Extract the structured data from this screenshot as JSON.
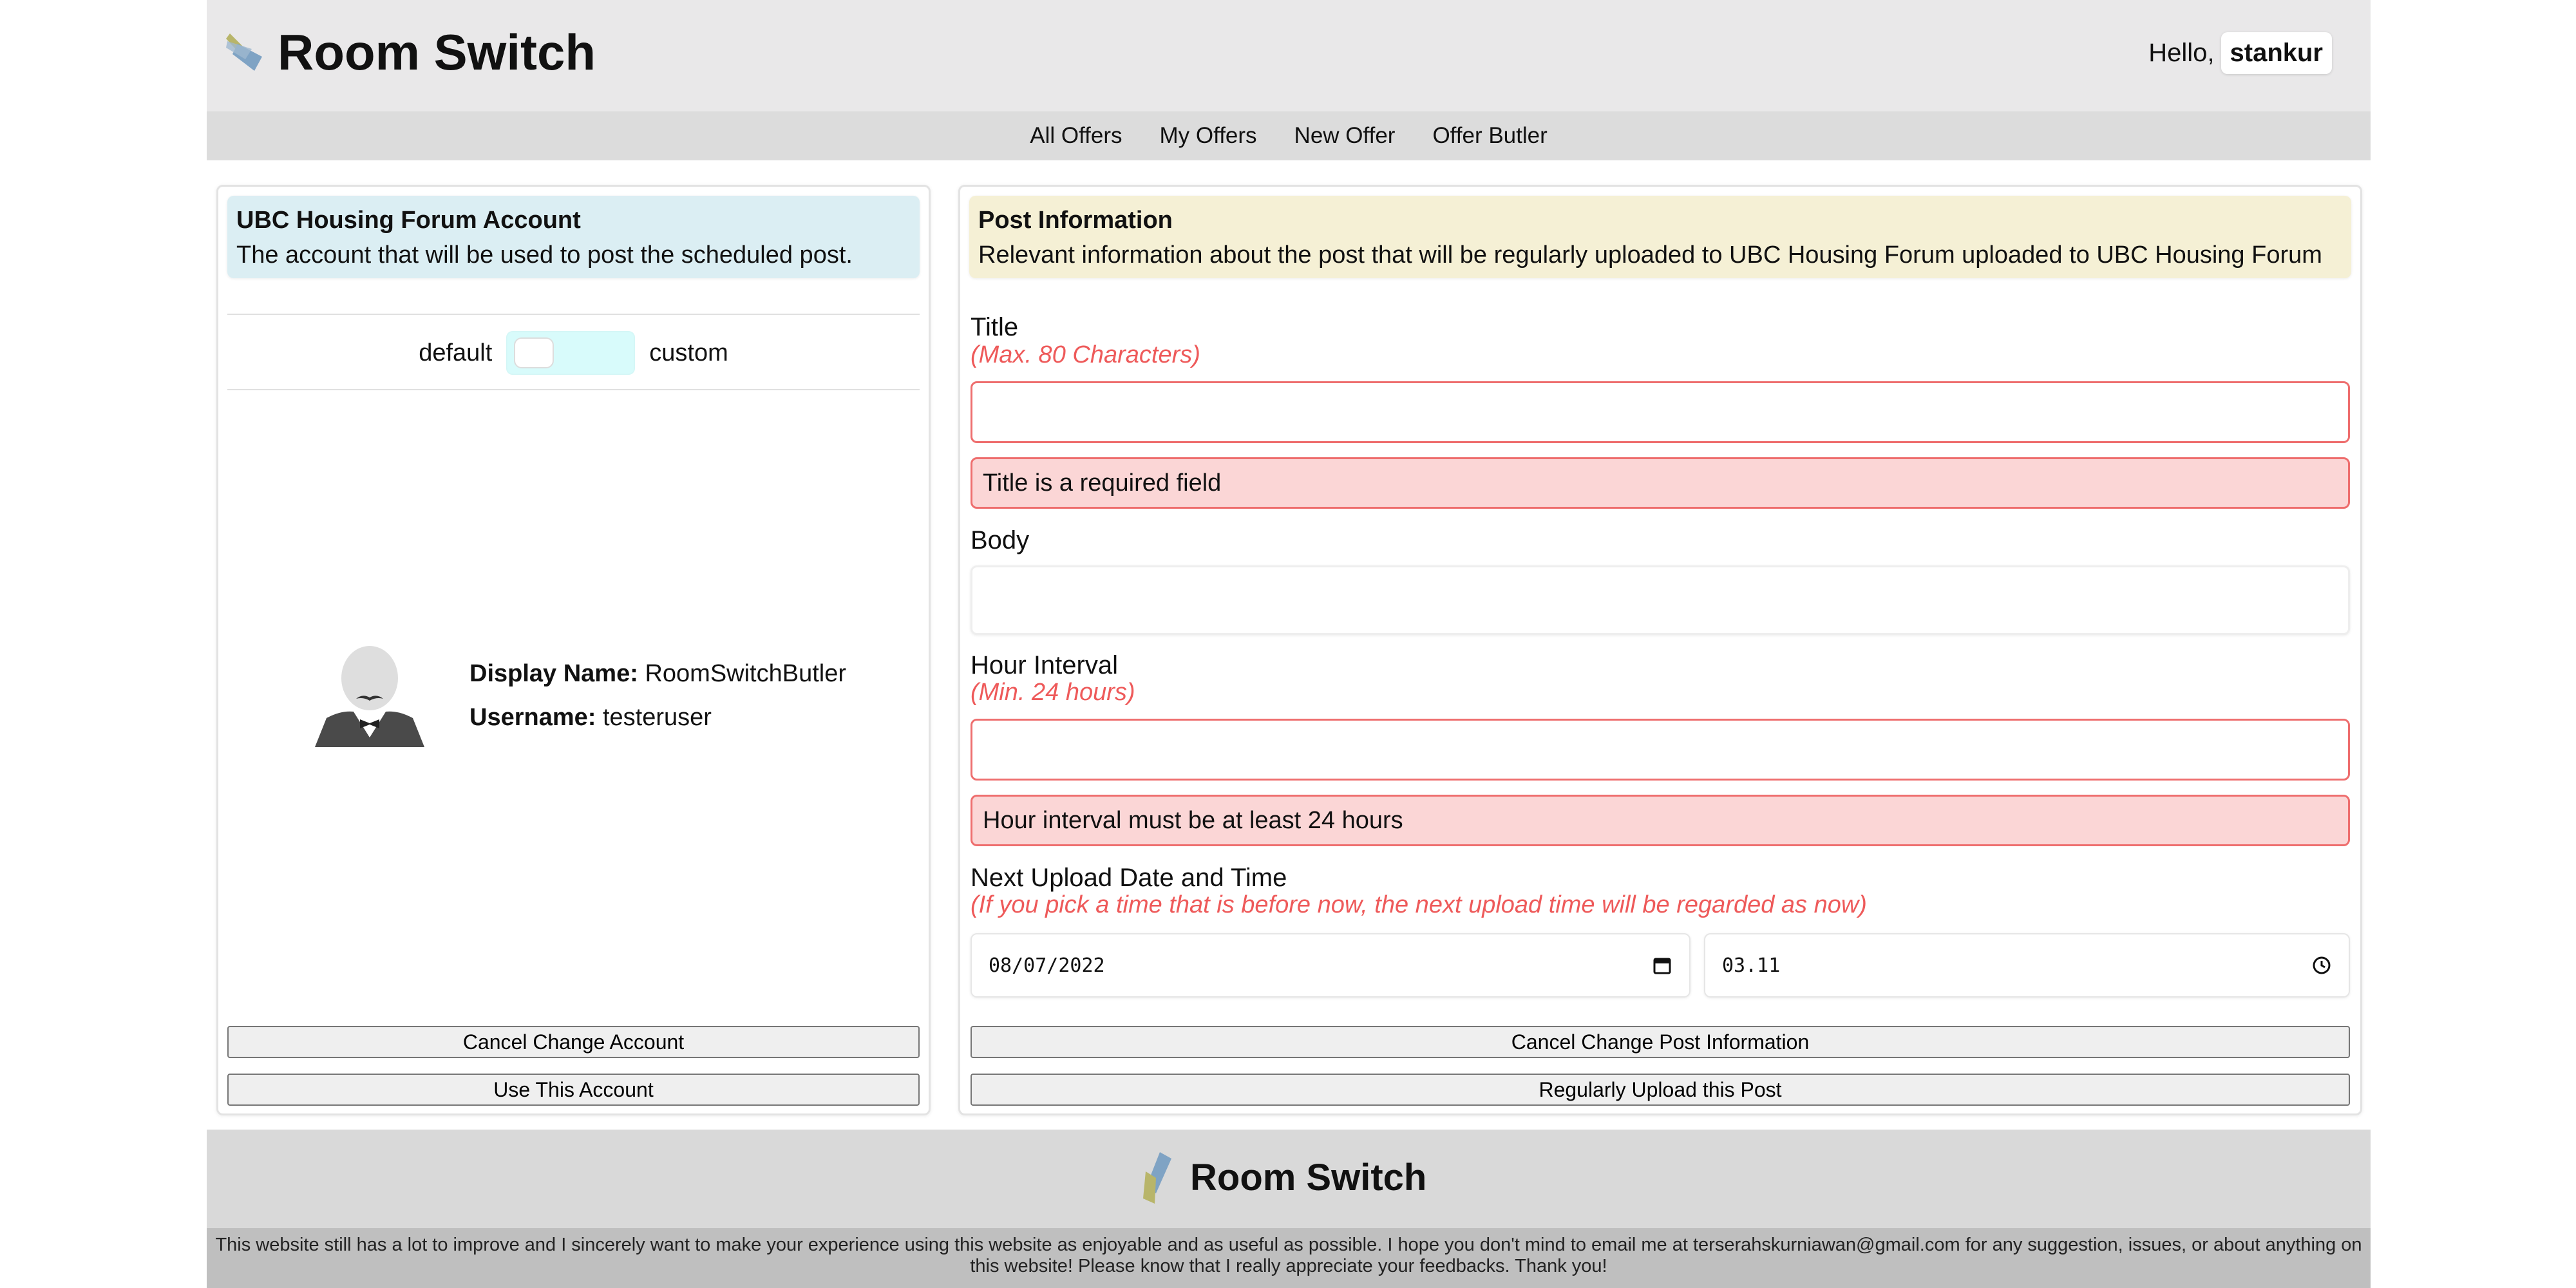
{
  "header": {
    "app_title": "Room Switch",
    "greeting": "Hello,",
    "username": "stankur"
  },
  "nav": {
    "items": [
      "All Offers",
      "My Offers",
      "New Offer",
      "Offer Butler"
    ]
  },
  "left_panel": {
    "info_title": "UBC Housing Forum Account",
    "info_sub": "The account that will be used to post the scheduled post.",
    "toggle_left": "default",
    "toggle_right": "custom",
    "display_name_label": "Display Name:",
    "display_name": "RoomSwitchButler",
    "username_label": "Username:",
    "username": "testeruser",
    "cancel_button": "Cancel Change Account",
    "use_button": "Use This Account"
  },
  "right_panel": {
    "info_title": "Post Information",
    "info_sub": "Relevant information about the post that will be regularly uploaded to UBC Housing Forum uploaded to UBC Housing Forum",
    "title_label": "Title",
    "title_hint": "(Max. 80 Characters)",
    "title_value": "",
    "title_error": "Title is a required field",
    "body_label": "Body",
    "body_value": "",
    "interval_label": "Hour Interval",
    "interval_hint": "(Min. 24 hours)",
    "interval_value": "",
    "interval_error": "Hour interval must be at least 24 hours",
    "next_upload_label": "Next Upload Date and Time",
    "next_upload_hint": "(If you pick a time that is before now, the next upload time will be regarded as now)",
    "date_value": "08/07/2022",
    "time_value": "03.11",
    "cancel_button": "Cancel Change Post Information",
    "upload_button": "Regularly Upload this Post"
  },
  "footer": {
    "title": "Room Switch",
    "note": "This website still has a lot to improve and I sincerely want to make your experience using this website as enjoyable and as useful as possible. I hope you don't mind to email me at terserahskurniawan@gmail.com for any suggestion, issues, or about anything on this website! Please know that I really appreciate your feedbacks. Thank you!"
  },
  "colors": {
    "header_bg": "#e9e8e9",
    "nav_bg": "#dcdcdc",
    "info_blue": "#dbeef3",
    "info_yellow": "#f5f0d5",
    "error_red": "#ee6e6e",
    "error_bg": "#fbd6d6",
    "logo_blue": "#7fa3c4",
    "logo_olive": "#b8b56a"
  },
  "icons": [
    "room-switch-logo-icon",
    "butler-avatar-icon",
    "calendar-icon",
    "clock-icon"
  ]
}
